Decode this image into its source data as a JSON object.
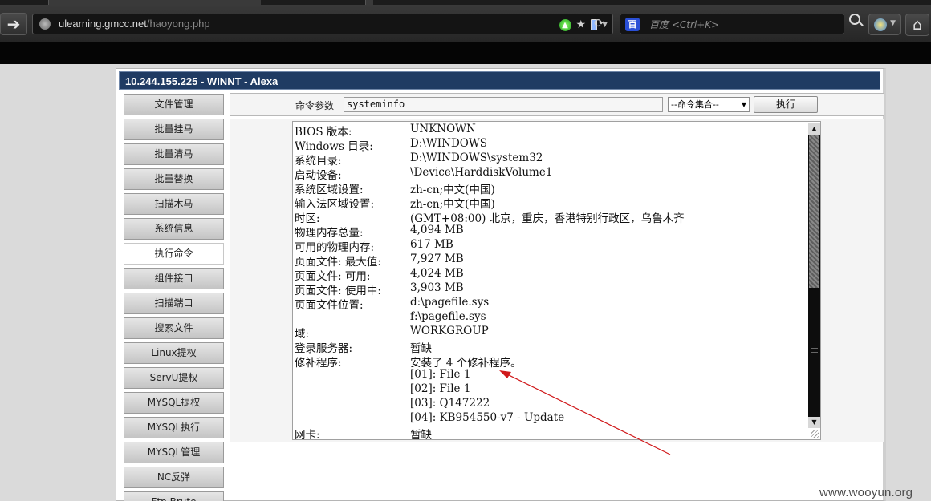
{
  "browser": {
    "url_host": "ulearning.gmcc.net",
    "url_path": "/haoyong.php",
    "search_placeholder": "百度 <Ctrl+K>",
    "search_engine_label": "百"
  },
  "window": {
    "title": "10.244.155.225 - WINNT - Alexa"
  },
  "sidebar": {
    "items": [
      {
        "label": "文件管理",
        "active": false
      },
      {
        "label": "批量挂马",
        "active": false
      },
      {
        "label": "批量清马",
        "active": false
      },
      {
        "label": "批量替换",
        "active": false
      },
      {
        "label": "扫描木马",
        "active": false
      },
      {
        "label": "系统信息",
        "active": false
      },
      {
        "label": "执行命令",
        "active": true
      },
      {
        "label": "组件接口",
        "active": false
      },
      {
        "label": "扫描端口",
        "active": false
      },
      {
        "label": "搜索文件",
        "active": false
      },
      {
        "label": "Linux提权",
        "active": false
      },
      {
        "label": "ServU提权",
        "active": false
      },
      {
        "label": "MYSQL提权",
        "active": false
      },
      {
        "label": "MYSQL执行",
        "active": false
      },
      {
        "label": "MYSQL管理",
        "active": false
      },
      {
        "label": "NC反弹",
        "active": false
      },
      {
        "label": "Ftp Brute",
        "active": false
      }
    ]
  },
  "command": {
    "label": "命令参数",
    "value": "systeminfo",
    "select_value": "--命令集合--",
    "execute_label": "执行"
  },
  "output": {
    "rows": [
      {
        "key": "BIOS 版本:",
        "value": "UNKNOWN"
      },
      {
        "key": "Windows 目录:",
        "value": "D:\\WINDOWS"
      },
      {
        "key": "系统目录:",
        "value": "D:\\WINDOWS\\system32"
      },
      {
        "key": "启动设备:",
        "value": "\\Device\\HarddiskVolume1"
      },
      {
        "key": "系统区域设置:",
        "value": "zh-cn;中文(中国)"
      },
      {
        "key": "输入法区域设置:",
        "value": "zh-cn;中文(中国)"
      },
      {
        "key": "时区:",
        "value": "(GMT+08:00) 北京，重庆，香港特别行政区，乌鲁木齐"
      },
      {
        "key": "物理内存总量:",
        "value": "4,094 MB"
      },
      {
        "key": "可用的物理内存:",
        "value": "617 MB"
      },
      {
        "key": "页面文件: 最大值:",
        "value": "7,927 MB"
      },
      {
        "key": "页面文件: 可用:",
        "value": "4,024 MB"
      },
      {
        "key": "页面文件: 使用中:",
        "value": "3,903 MB"
      },
      {
        "key": "页面文件位置:",
        "value": "d:\\pagefile.sys"
      },
      {
        "key": "",
        "value": "f:\\pagefile.sys"
      },
      {
        "key": "域:",
        "value": "WORKGROUP"
      },
      {
        "key": "登录服务器:",
        "value": "暂缺"
      },
      {
        "key": "修补程序:",
        "value": "安装了 4 个修补程序。"
      },
      {
        "key": "",
        "value": "[01]: File 1"
      },
      {
        "key": "",
        "value": "[02]: File 1"
      },
      {
        "key": "",
        "value": "[03]: Q147222"
      },
      {
        "key": "",
        "value": "[04]: KB954550-v7 - Update"
      },
      {
        "key": "网卡:",
        "value": "暂缺"
      }
    ]
  },
  "annotation": {
    "color": "#d0191b"
  },
  "watermark": "www.wooyun.org"
}
